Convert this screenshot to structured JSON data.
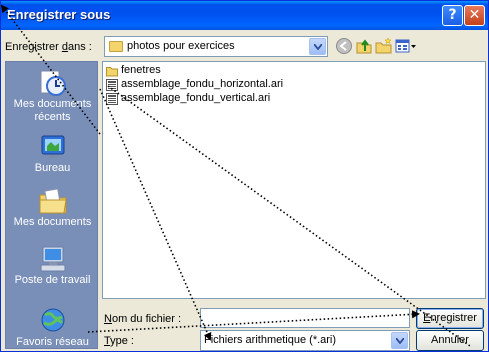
{
  "window": {
    "title": "Enregistrer sous",
    "help_symbol": "?",
    "close_symbol": "✕"
  },
  "toolbar": {
    "save_in_label_prefix": "Enregistrer ",
    "save_in_label_underlined": "d",
    "save_in_label_suffix": "ans :",
    "location_value": "photos pour exercices"
  },
  "places": [
    {
      "label_line1": "Mes documents",
      "label_line2": "récents",
      "icon": "recent-documents-icon"
    },
    {
      "label_line1": "Bureau",
      "label_line2": "",
      "icon": "desktop-icon"
    },
    {
      "label_line1": "Mes documents",
      "label_line2": "",
      "icon": "my-documents-icon"
    },
    {
      "label_line1": "Poste de travail",
      "label_line2": "",
      "icon": "my-computer-icon"
    },
    {
      "label_line1": "Favoris réseau",
      "label_line2": "",
      "icon": "network-places-icon"
    }
  ],
  "files": [
    {
      "name": "fenetres",
      "type": "folder"
    },
    {
      "name": "assemblage_fondu_horizontal.ari",
      "type": "file"
    },
    {
      "name": "assemblage_fondu_vertical.ari",
      "type": "file"
    }
  ],
  "footer": {
    "filename_label_underlined": "N",
    "filename_label_rest": "om du fichier :",
    "filename_value": "",
    "type_label_underlined": "T",
    "type_label_rest": "ype :",
    "type_value": "Fichiers arithmetique (*.ari)",
    "save_button_underlined": "E",
    "save_button_rest": "nregistrer",
    "cancel_button": "Annuler"
  }
}
